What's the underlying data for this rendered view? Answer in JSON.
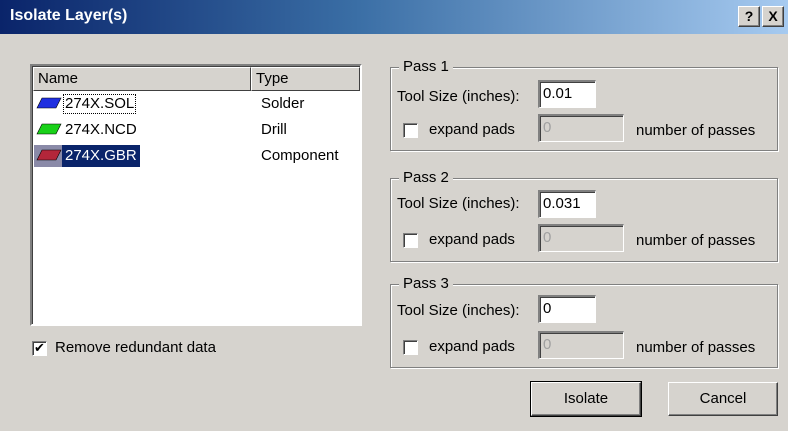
{
  "window": {
    "title": "Isolate Layer(s)",
    "help_label": "?",
    "close_label": "X"
  },
  "layers_list": {
    "columns": [
      "Name",
      "Type"
    ],
    "items": [
      {
        "name": "274X.SOL",
        "type": "Solder",
        "color": "#1f2fe0",
        "focused": true,
        "selected": false
      },
      {
        "name": "274X.NCD",
        "type": "Drill",
        "color": "#19d119",
        "focused": false,
        "selected": false
      },
      {
        "name": "274X.GBR",
        "type": "Component",
        "color": "#b3263a",
        "focused": false,
        "selected": true
      }
    ]
  },
  "remove_redundant": {
    "label": "Remove redundant data",
    "checked": true,
    "mark": "✔"
  },
  "passes": [
    {
      "legend": "Pass 1",
      "tool_size_label": "Tool Size (inches):",
      "tool_size": "0.01",
      "expand_label": "expand pads",
      "expand_checked": false,
      "passes_value": "0",
      "passes_label": "number of passes"
    },
    {
      "legend": "Pass 2",
      "tool_size_label": "Tool Size (inches):",
      "tool_size": "0.031",
      "expand_label": "expand pads",
      "expand_checked": false,
      "passes_value": "0",
      "passes_label": "number of passes"
    },
    {
      "legend": "Pass 3",
      "tool_size_label": "Tool Size (inches):",
      "tool_size": "0",
      "expand_label": "expand pads",
      "expand_checked": false,
      "passes_value": "0",
      "passes_label": "number of passes"
    }
  ],
  "buttons": {
    "isolate": "Isolate",
    "cancel": "Cancel"
  }
}
